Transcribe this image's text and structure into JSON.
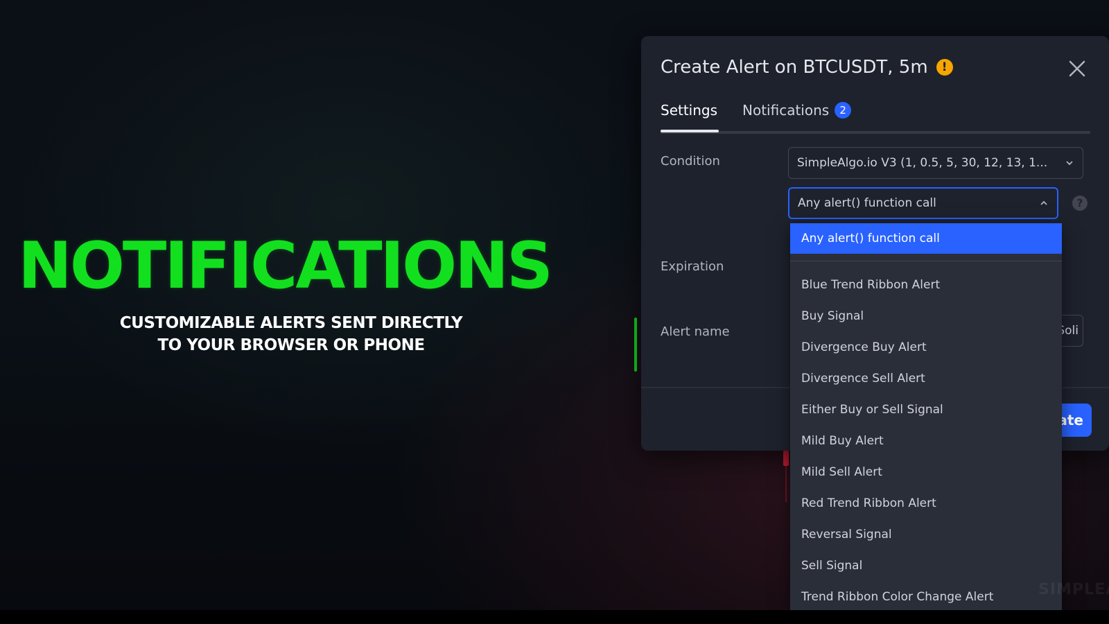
{
  "hero": {
    "title": "NOTIFICATIONS",
    "subtitle_line1": "CUSTOMIZABLE ALERTS SENT DIRECTLY",
    "subtitle_line2": "TO YOUR BROWSER OR PHONE"
  },
  "dialog": {
    "title": "Create Alert on BTCUSDT, 5m",
    "warning_badge": "!",
    "close_icon": "close-icon",
    "tabs": [
      {
        "label": "Settings",
        "active": true
      },
      {
        "label": "Notifications",
        "badge": "2"
      }
    ],
    "condition": {
      "label": "Condition",
      "indicator_value": "SimpleAlgo.io V3 (1, 0.5, 5, 30, 12, 13, 1...",
      "trigger_value": "Any alert() function call"
    },
    "help_badge": "?",
    "expiration": {
      "label": "Expiration"
    },
    "alert_name": {
      "label": "Alert name",
      "value_partial": "Soli"
    },
    "create_button": "ate"
  },
  "dropdown": {
    "selected": "Any alert() function call",
    "items": [
      "Blue Trend Ribbon Alert",
      "Buy Signal",
      "Divergence Buy Alert",
      "Divergence Sell Alert",
      "Either Buy or Sell Signal",
      "Mild Buy Alert",
      "Mild Sell Alert",
      "Red Trend Ribbon Alert",
      "Reversal Signal",
      "Sell Signal",
      "Trend Ribbon Color Change Alert"
    ]
  },
  "watermark": "SIMPLEAL",
  "colors": {
    "accent": "#2962ff",
    "hero_green": "#12e01f",
    "warning": "#f7a600",
    "dialog_bg": "#1e222d"
  }
}
